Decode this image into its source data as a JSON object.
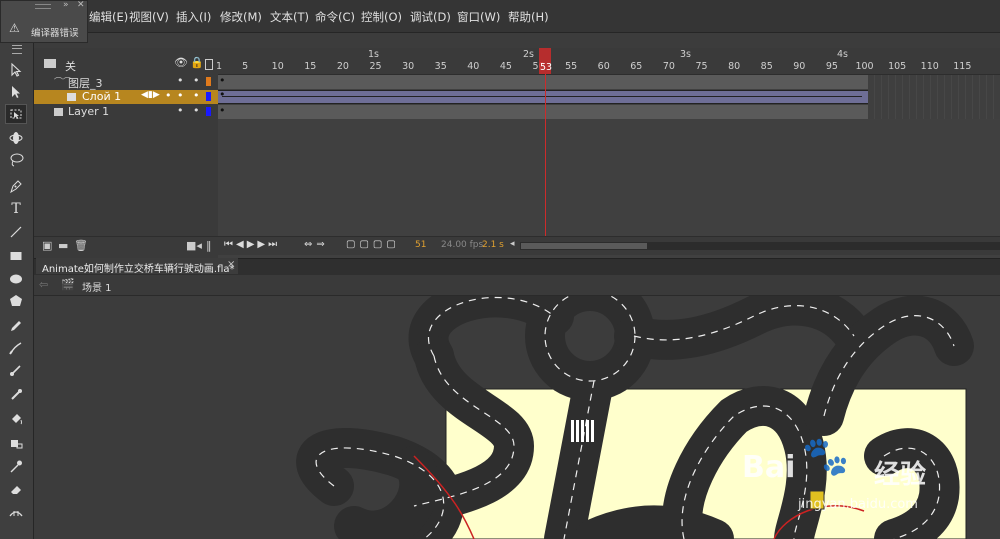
{
  "menu": [
    "编辑(E)",
    "视图(V)",
    "插入(I)",
    "修改(M)",
    "文本(T)",
    "命令(C)",
    "控制(O)",
    "调试(D)",
    "窗口(W)",
    "帮助(H)"
  ],
  "error_panel": {
    "title": "编译器错误"
  },
  "timeline": {
    "header_label": "关",
    "seconds": [
      "1s",
      "2s",
      "3s",
      "4s"
    ],
    "frame_ticks": [
      "1",
      "5",
      "10",
      "15",
      "20",
      "25",
      "30",
      "35",
      "40",
      "45",
      "50",
      "55",
      "60",
      "65",
      "70",
      "75",
      "80",
      "85",
      "90",
      "95",
      "100",
      "105",
      "110",
      "115"
    ],
    "playhead_frame": "53",
    "layers": [
      {
        "name": "图层_3",
        "color": "#e07a1c",
        "selected": false
      },
      {
        "name": "Слой 1",
        "color": "#1a1aff",
        "selected": true
      },
      {
        "name": "Layer 1",
        "color": "#1a1aff",
        "selected": false
      }
    ],
    "current_frame": "51",
    "fps": "24.00 fps",
    "time": "2.1 s"
  },
  "document": {
    "tab_title": "Animate如何制作立交桥车辆行驶动画.fla*",
    "close": "×",
    "scene_label": "场景 1"
  },
  "watermark": {
    "brand": "Bai",
    "brand2": "经验",
    "url": "jingyan.baidu.com"
  },
  "colors": {
    "stage": "#ffffcc",
    "road": "#3a3a3a",
    "selection": "#b7861f",
    "playhead": "#cc2b2b"
  }
}
